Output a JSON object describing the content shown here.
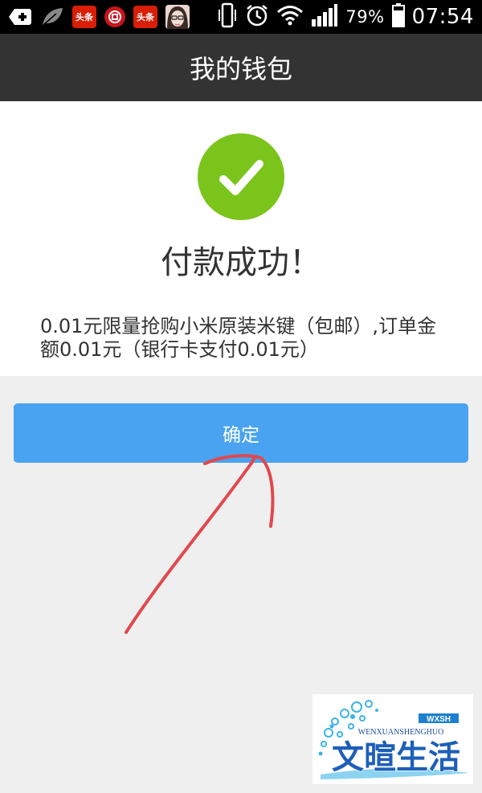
{
  "status_bar": {
    "icons": [
      "add-icon",
      "leaf-icon",
      "toutiao-app-icon",
      "bank-app-icon",
      "toutiao-app-icon",
      "avatar-icon",
      "vibrate-icon",
      "alarm-icon",
      "wifi-icon",
      "signal-icon",
      "battery-icon"
    ],
    "news_app_label": "头条",
    "battery_percent": "79%",
    "time": "07:54"
  },
  "header": {
    "title": "我的钱包"
  },
  "result": {
    "status_icon": "check-icon",
    "title": "付款成功！",
    "description": "0.01元限量抢购小米原装米键（包邮）,订单金额0.01元（银行卡支付0.01元）"
  },
  "actions": {
    "confirm_label": "确定"
  },
  "watermark": {
    "subtitle": "WENXUANSHENGHUO",
    "badge": "WXSH",
    "name": "文暄生活"
  },
  "colors": {
    "nav_background": "#333333",
    "success_green": "#7bc41c",
    "button_blue": "#4aa3f0",
    "annotation_red": "#e0494e"
  }
}
